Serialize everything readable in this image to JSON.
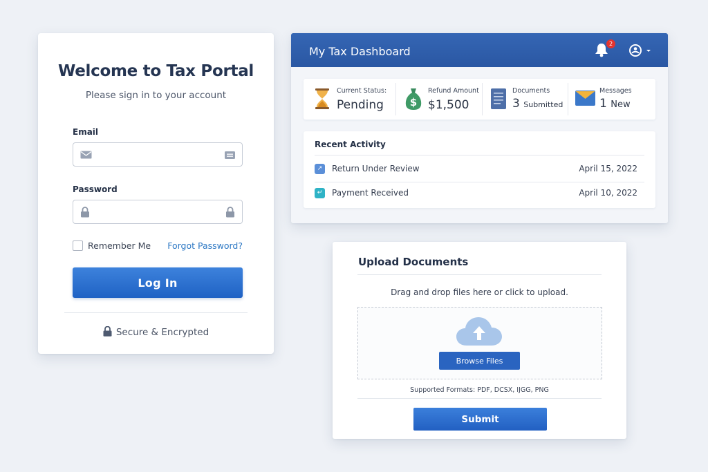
{
  "login": {
    "title": "Welcome to Tax Portal",
    "subtitle": "Please sign in to your account",
    "email_label": "Email",
    "email_value": "",
    "email_placeholder": "",
    "password_label": "Password",
    "password_value": "",
    "password_placeholder": "",
    "remember_label": "Remember Me",
    "remember_checked": false,
    "forgot_label": "Forgot Password?",
    "login_button": "Log In",
    "secure_text": "Secure & Encrypted",
    "icons": [
      "envelope-icon",
      "id-card-icon",
      "lock-icon",
      "lock-icon",
      "lock-icon"
    ]
  },
  "dashboard": {
    "title": "My Tax Dashboard",
    "notification_count": "2",
    "icons": [
      "bell-icon",
      "user-circle-icon",
      "caret-down-icon"
    ],
    "stats": [
      {
        "label": "Current Status:",
        "value": "Pending",
        "unit": "",
        "icon": "hourglass-icon"
      },
      {
        "label": "Refund Amount",
        "value": "$1,500",
        "unit": "",
        "icon": "money-bag-icon"
      },
      {
        "label": "Documents",
        "value": "3",
        "unit": "Submitted",
        "icon": "document-icon"
      },
      {
        "label": "Messages",
        "value": "1",
        "unit": "New",
        "icon": "envelope-icon"
      }
    ],
    "activity": {
      "title": "Recent Activity",
      "items": [
        {
          "label": "Return Under Review",
          "date": "April 15, 2022",
          "icon": "review-icon",
          "color": "#5b8fd8"
        },
        {
          "label": "Payment Received",
          "date": "April 10, 2022",
          "icon": "payment-icon",
          "color": "#2fb3c6"
        }
      ]
    }
  },
  "upload": {
    "title": "Upload Documents",
    "hint": "Drag and drop files here  or click to upload.",
    "browse_button": "Browse Files",
    "formats": "Supported Formats: PDF, DCSX, IJGG, PNG",
    "submit_button": "Submit",
    "icon": "cloud-upload-icon"
  },
  "colors": {
    "primary": "#2a64c0",
    "header": "#2f5eab",
    "link": "#2d78c4",
    "badge": "#e3342f",
    "background": "#eef1f6"
  }
}
